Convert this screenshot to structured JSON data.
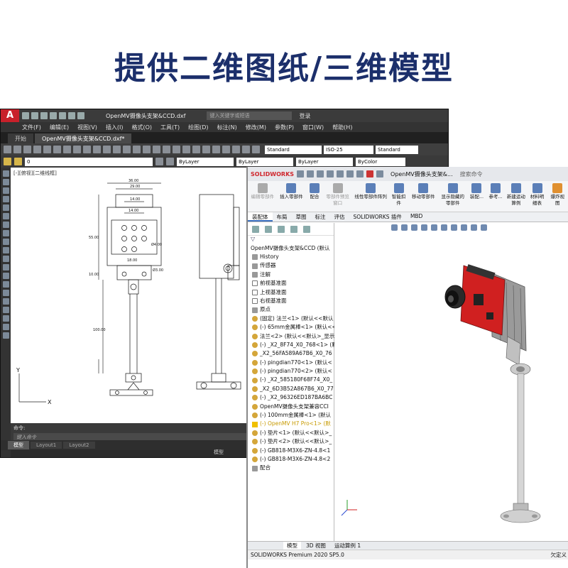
{
  "headline": "提供二维图纸/三维模型",
  "cad": {
    "logo": "A",
    "filename": "OpenMV摄像头支架&CCD.dxf",
    "search_placeholder": "键入关键字或短语",
    "login": "登录",
    "menu": [
      "文件(F)",
      "编辑(E)",
      "视图(V)",
      "插入(I)",
      "格式(O)",
      "工具(T)",
      "绘图(D)",
      "标注(N)",
      "修改(M)",
      "参数(P)",
      "窗口(W)",
      "帮助(H)"
    ],
    "tabs": [
      "开始",
      "OpenMV摄像头支架&CCD.dxf*"
    ],
    "layer_value": "0",
    "text_style": "Standard",
    "dim_style": "ISO-25",
    "table_style": "Standard",
    "color": "ByLayer",
    "linetype": "ByLayer",
    "lineweight": "ByLayer",
    "plotstyle": "ByColor",
    "view_label": "[-][俯视][二维线框]",
    "cmd_label": "命令:",
    "cmd_placeholder": "键入命令",
    "layout_tabs": [
      "模型",
      "Layout1",
      "Layout2"
    ],
    "status_model": "模型",
    "dims": {
      "d36": "36.00",
      "d29": "29.00",
      "d14": "14.00",
      "d18": "18.00",
      "d55": "55.00",
      "d10": "10.00",
      "d100": "100.00",
      "d3": "Ø3.00",
      "d4": "Ø4.00"
    },
    "axis_y": "Y",
    "axis_x": "X"
  },
  "sw": {
    "logo": "SOLIDWORKS",
    "filename": "OpenMV摄像头支架&...",
    "search": "搜索命令",
    "ribbon": [
      {
        "label": "编辑零部件",
        "grey": true
      },
      {
        "label": "插入零部件",
        "grey": false
      },
      {
        "label": "配合",
        "grey": false
      },
      {
        "label": "零部件预览窗口",
        "grey": true
      },
      {
        "label": "线性零部件阵列",
        "grey": false
      },
      {
        "label": "智能扣件",
        "grey": false
      },
      {
        "label": "移动零部件",
        "grey": false
      },
      {
        "label": "显示隐藏的零部件",
        "grey": false
      },
      {
        "label": "装配...",
        "grey": false
      },
      {
        "label": "参考...",
        "grey": false
      },
      {
        "label": "新建运动算例",
        "grey": false
      },
      {
        "label": "材料明细表",
        "grey": false
      },
      {
        "label": "爆炸视图",
        "grey": false
      }
    ],
    "cmd_tabs": [
      "装配体",
      "布局",
      "草图",
      "标注",
      "评估",
      "SOLIDWORKS 插件",
      "MBD"
    ],
    "tree_root": "OpenMV摄像头支架&CCD (默认",
    "tree": [
      {
        "label": "History",
        "type": "misc"
      },
      {
        "label": "传感器",
        "type": "misc"
      },
      {
        "label": "注解",
        "type": "misc"
      },
      {
        "label": "前视基准面",
        "type": "plane"
      },
      {
        "label": "上视基准面",
        "type": "plane"
      },
      {
        "label": "右视基准面",
        "type": "plane"
      },
      {
        "label": "原点",
        "type": "misc"
      },
      {
        "label": "(固定) 法兰<1> (默认<<默认",
        "type": "part"
      },
      {
        "label": "(-) 65mm金属棒<1> (默认<<",
        "type": "part"
      },
      {
        "label": "法兰<2> (默认<<默认>_显示",
        "type": "part"
      },
      {
        "label": "(-) _X2_8F74_X0_768<1> (默",
        "type": "part"
      },
      {
        "label": "_X2_56FA589A67B6_X0_76",
        "type": "part"
      },
      {
        "label": "(-) pingdian770<1> (默认<",
        "type": "part"
      },
      {
        "label": "(-) pingdian770<2> (默认<",
        "type": "part"
      },
      {
        "label": "(-) _X2_585180F68F74_X0_",
        "type": "part"
      },
      {
        "label": "_X2_6D3B52A867B6_X0_77",
        "type": "part"
      },
      {
        "label": "(-) _X2_96326ED187BA6BC",
        "type": "part"
      },
      {
        "label": "OpenMV摄像头支架兼容CCI",
        "type": "part"
      },
      {
        "label": "(-) 100mm金属棒<1> (默认",
        "type": "part"
      },
      {
        "label": "(-) OpenMV H7 Pro<1> (默",
        "type": "warn"
      },
      {
        "label": "(-) 垫片<1> (默认<<默认>_",
        "type": "part"
      },
      {
        "label": "(-) 垫片<2> (默认<<默认>_",
        "type": "part"
      },
      {
        "label": "(-) GB818-M3X6-ZN-4.8<1",
        "type": "part"
      },
      {
        "label": "(-) GB818-M3X6-ZN-4.8<2",
        "type": "part"
      },
      {
        "label": "配合",
        "type": "misc"
      }
    ],
    "bottom_tabs": [
      "模型",
      "3D 视图",
      "运动算例 1"
    ],
    "status_left": "SOLIDWORKS Premium 2020 SP5.0",
    "status_right": "欠定义"
  },
  "colors": {
    "headline": "#1c2f6b",
    "cad_bg": "#2b2b2b",
    "acad_red": "#c8202a",
    "sw_red": "#d0272d",
    "pcb_red": "#d02020"
  }
}
